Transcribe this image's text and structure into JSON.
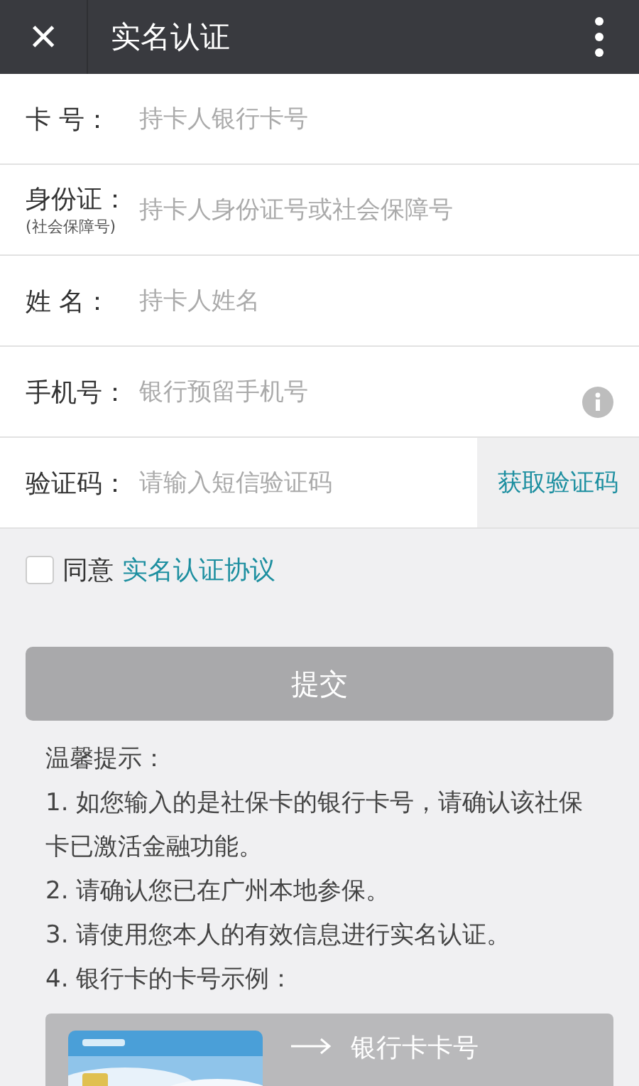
{
  "navbar": {
    "close_icon": "×",
    "title": "实名认证"
  },
  "form": {
    "rows": [
      {
        "kind": "plain",
        "label": "卡 号：",
        "placeholder": "持卡人银行卡号"
      },
      {
        "kind": "plain",
        "label": "身份证：",
        "sublabel": "(社会保障号)",
        "placeholder": "持卡人身份证号或社会保障号"
      },
      {
        "kind": "plain",
        "label": "姓 名：",
        "placeholder": "持卡人姓名"
      },
      {
        "kind": "info",
        "label": "手机号：",
        "placeholder": "银行预留手机号"
      },
      {
        "kind": "code",
        "label": "验证码：",
        "placeholder": "请输入短信验证码",
        "action": "获取验证码"
      }
    ]
  },
  "agreement": {
    "checked": false,
    "text": "同意",
    "link": "实名认证协议"
  },
  "submit": {
    "label": "提交",
    "disabled": true
  },
  "tips": {
    "title": "温馨提示：",
    "items": [
      "1. 如您输入的是社保卡的银行卡号，请确认该社保卡已激活金融功能。",
      "2. 请确认您已在广州本地参保。",
      "3. 请使用您本人的有效信息进行实名认证。",
      "4. 银行卡的卡号示例："
    ]
  },
  "example": {
    "label": "银行卡卡号"
  }
}
